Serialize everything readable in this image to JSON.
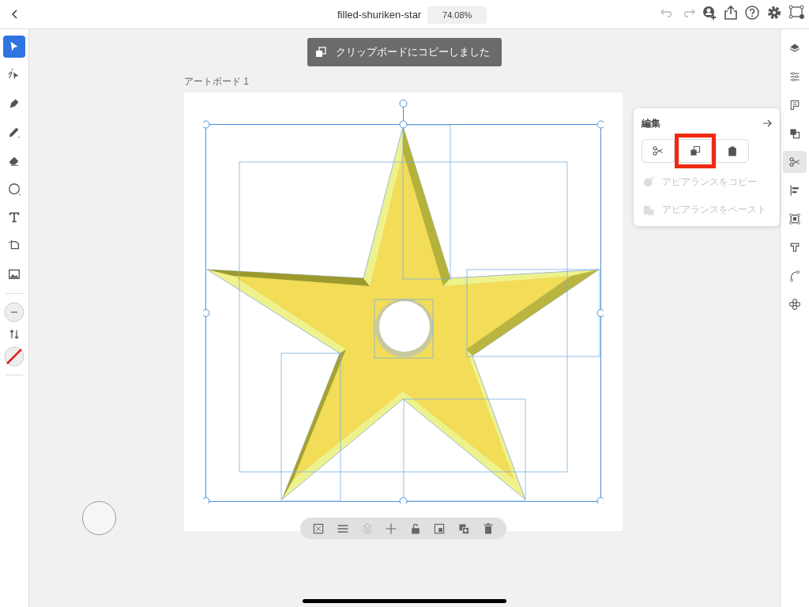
{
  "topbar": {
    "document_title": "filled-shuriken-star",
    "zoom": "74.08%"
  },
  "left_tools": [
    {
      "kind": "select",
      "selected": true
    },
    {
      "kind": "direct",
      "selected": false
    },
    {
      "kind": "pen",
      "selected": false
    },
    {
      "kind": "pencil",
      "selected": false
    },
    {
      "kind": "eraser",
      "selected": false
    },
    {
      "kind": "ellipse",
      "selected": false
    },
    {
      "kind": "text",
      "selected": false
    },
    {
      "kind": "crop",
      "selected": false
    },
    {
      "kind": "image",
      "selected": false
    }
  ],
  "toast": {
    "message": "クリップボードにコピーしました"
  },
  "artboard": {
    "label": "アートボード 1"
  },
  "edit_panel": {
    "title": "編集",
    "buttons": [
      {
        "kind": "cut",
        "highlighted": false
      },
      {
        "kind": "copy",
        "highlighted": true
      },
      {
        "kind": "paste",
        "highlighted": false
      }
    ],
    "items": [
      {
        "kind": "copy-appearance",
        "label": "アピアランスをコピー",
        "disabled": true
      },
      {
        "kind": "paste-appearance",
        "label": "アピアランスをペースト",
        "disabled": true
      }
    ]
  },
  "right_tools": [
    {
      "kind": "layers",
      "selected": false
    },
    {
      "kind": "properties",
      "selected": false
    },
    {
      "kind": "ruler",
      "selected": false
    },
    {
      "kind": "combine",
      "selected": false
    },
    {
      "kind": "cut",
      "selected": true
    },
    {
      "kind": "align",
      "selected": false
    },
    {
      "kind": "transform",
      "selected": false
    },
    {
      "kind": "type",
      "selected": false
    },
    {
      "kind": "path",
      "selected": false
    },
    {
      "kind": "repeat",
      "selected": false
    }
  ],
  "bottom_toolbar": [
    {
      "kind": "mask",
      "disabled": false
    },
    {
      "kind": "arrange",
      "disabled": false
    },
    {
      "kind": "flatten",
      "disabled": true
    },
    {
      "kind": "move",
      "disabled": false
    },
    {
      "kind": "lock",
      "disabled": false
    },
    {
      "kind": "group",
      "disabled": false
    },
    {
      "kind": "duplicate",
      "disabled": false
    },
    {
      "kind": "delete",
      "disabled": false
    }
  ]
}
